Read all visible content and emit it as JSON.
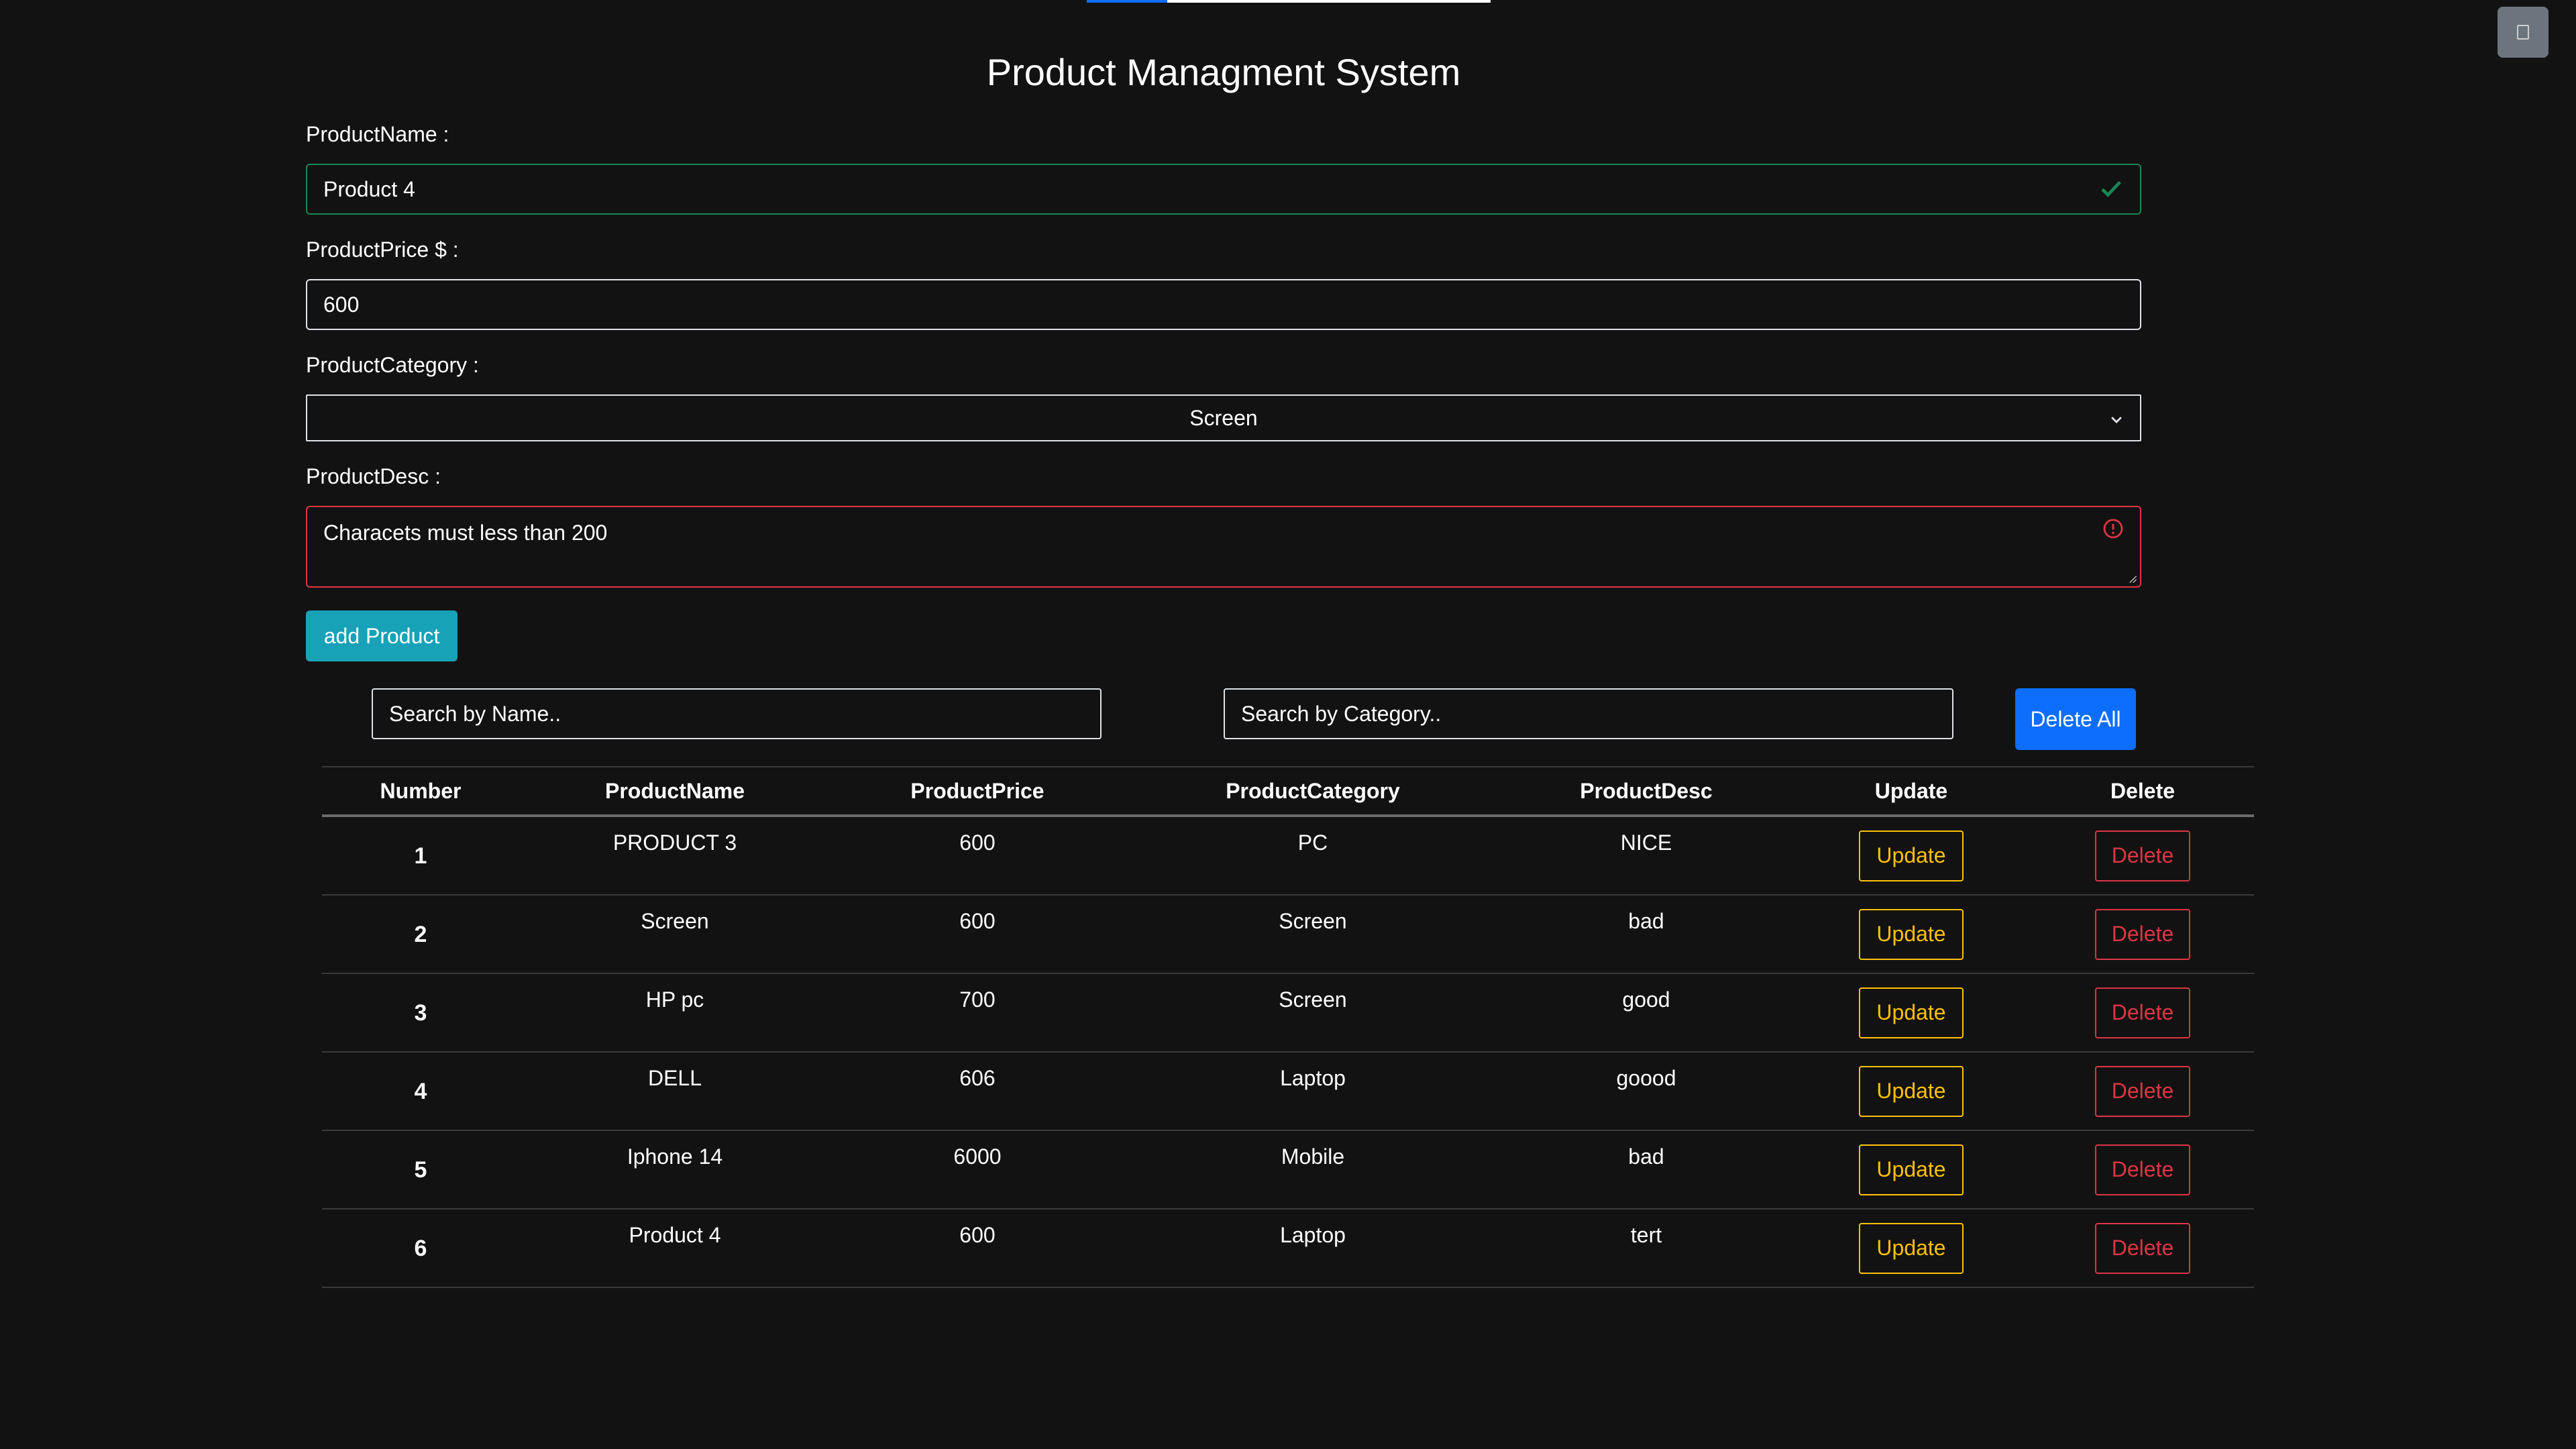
{
  "top_progress": {
    "fraction": 0.2
  },
  "corner_button": {
    "label": ""
  },
  "title": "Product Managment System",
  "form": {
    "name_label": "ProductName :",
    "name_value": "Product 4",
    "price_label": "ProductPrice $ :",
    "price_value": "600",
    "category_label": "ProductCategory :",
    "category_value": "Screen",
    "desc_label": "ProductDesc :",
    "desc_value": "Characets must less than 200",
    "add_button": "add Product"
  },
  "search": {
    "name_placeholder": "Search by Name..",
    "category_placeholder": "Search by Category..",
    "delete_all": "Delete All"
  },
  "table": {
    "headers": [
      "Number",
      "ProductName",
      "ProductPrice",
      "ProductCategory",
      "ProductDesc",
      "Update",
      "Delete"
    ],
    "rows": [
      {
        "number": "1",
        "name": "PRODUCT 3",
        "price": "600",
        "category": "PC",
        "desc": "NICE",
        "update": "Update",
        "delete": "Delete"
      },
      {
        "number": "2",
        "name": "Screen",
        "price": "600",
        "category": "Screen",
        "desc": "bad",
        "update": "Update",
        "delete": "Delete"
      },
      {
        "number": "3",
        "name": "HP pc",
        "price": "700",
        "category": "Screen",
        "desc": "good",
        "update": "Update",
        "delete": "Delete"
      },
      {
        "number": "4",
        "name": "DELL",
        "price": "606",
        "category": "Laptop",
        "desc": "goood",
        "update": "Update",
        "delete": "Delete"
      },
      {
        "number": "5",
        "name": "Iphone 14",
        "price": "6000",
        "category": "Mobile",
        "desc": "bad",
        "update": "Update",
        "delete": "Delete"
      },
      {
        "number": "6",
        "name": "Product 4",
        "price": "600",
        "category": "Laptop",
        "desc": "tert",
        "update": "Update",
        "delete": "Delete"
      }
    ]
  },
  "colors": {
    "background": "#121212",
    "valid": "#198754",
    "invalid": "#dc3545",
    "add_button": "#17a2b8",
    "delete_all": "#0d6efd",
    "update": "#ffc107",
    "delete": "#dc3545"
  },
  "icons": {
    "valid": "check-icon",
    "invalid": "exclamation-circle-icon",
    "select": "chevron-down-icon",
    "corner": "square-icon"
  }
}
